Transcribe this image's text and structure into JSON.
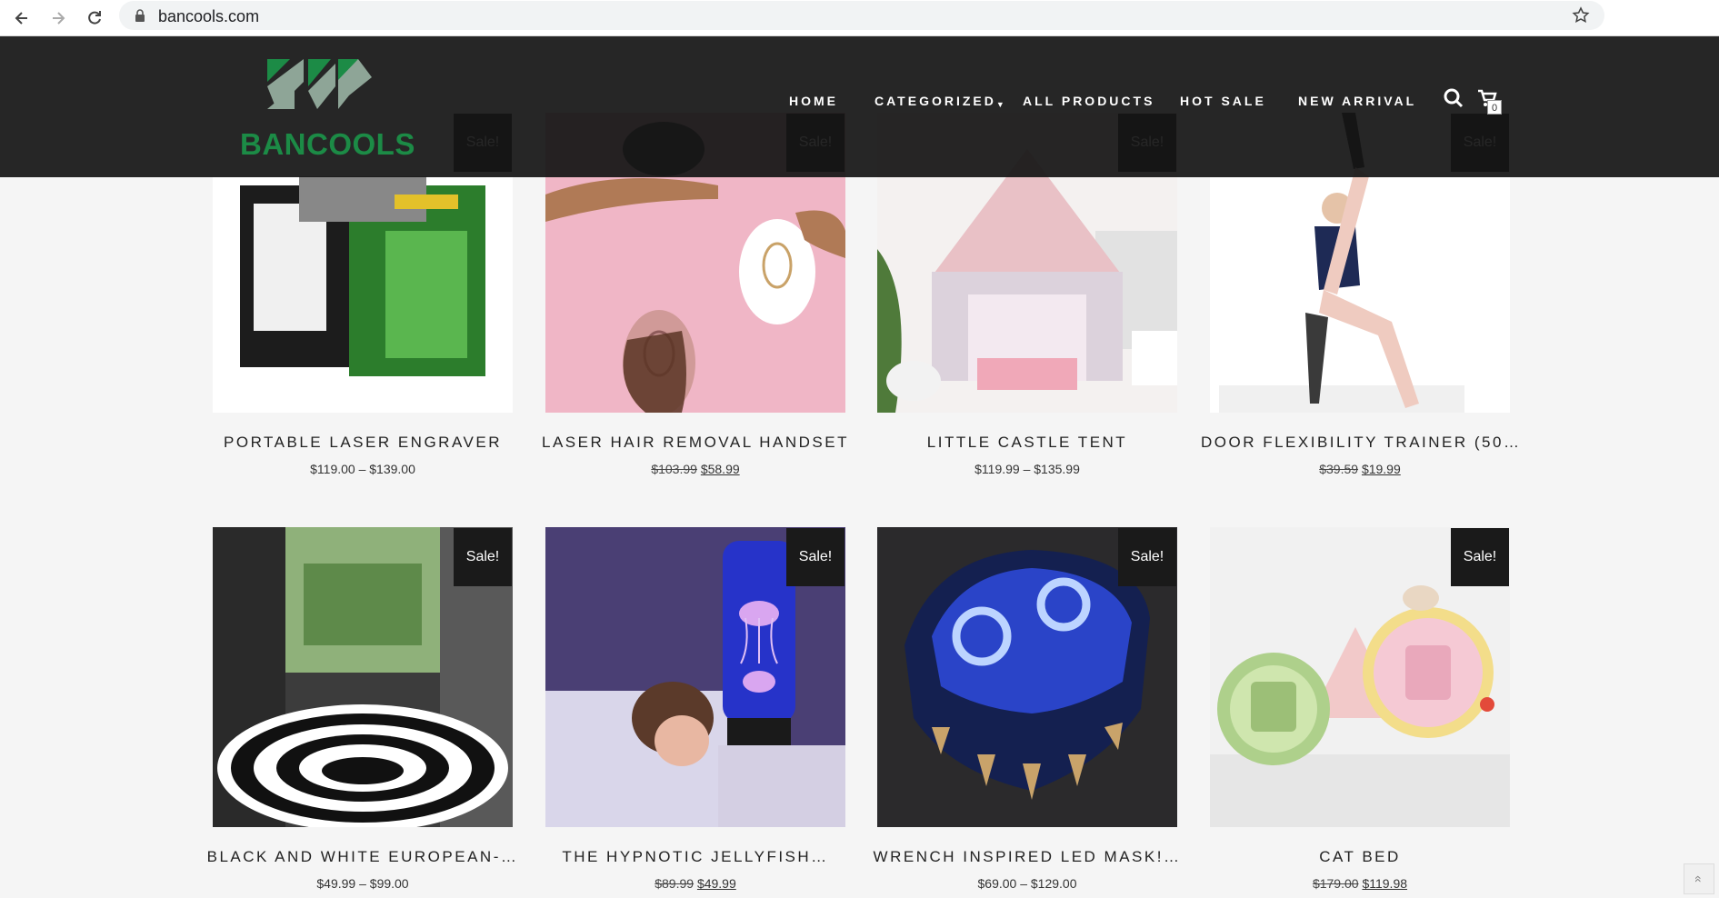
{
  "browser": {
    "url": "bancools.com"
  },
  "site": {
    "logo_text": "BANCOOLS",
    "nav": {
      "home": "HOME",
      "categorized": "CATEGORIZED",
      "all_products": "ALL PRODUCTS",
      "hot_sale": "HOT SALE",
      "new_arrival": "NEW ARRIVAL"
    },
    "cart_count": "0",
    "sale_label": "Sale!",
    "products": [
      {
        "title": "PORTABLE LASER ENGRAVER",
        "price": "$119.00 – $139.00",
        "sale": true
      },
      {
        "title": "LASER HAIR REMOVAL HANDSET",
        "old_price": "$103.99",
        "new_price": "$58.99",
        "sale": true
      },
      {
        "title": "LITTLE CASTLE TENT",
        "price": "$119.99 – $135.99",
        "sale": true
      },
      {
        "title": "DOOR FLEXIBILITY TRAINER (50…",
        "old_price": "$39.59",
        "new_price": "$19.99",
        "sale": true
      },
      {
        "title": "BLACK AND WHITE EUROPEAN-…",
        "price": "$49.99 – $99.00",
        "sale": true
      },
      {
        "title": "THE HYPNOTIC JELLYFISH…",
        "old_price": "$89.99",
        "new_price": "$49.99",
        "sale": true
      },
      {
        "title": "WRENCH INSPIRED LED MASK!…",
        "price": "$69.00 – $129.00",
        "sale": true
      },
      {
        "title": "CAT BED",
        "old_price": "$179.00",
        "new_price": "$119.98",
        "sale": true
      }
    ]
  }
}
